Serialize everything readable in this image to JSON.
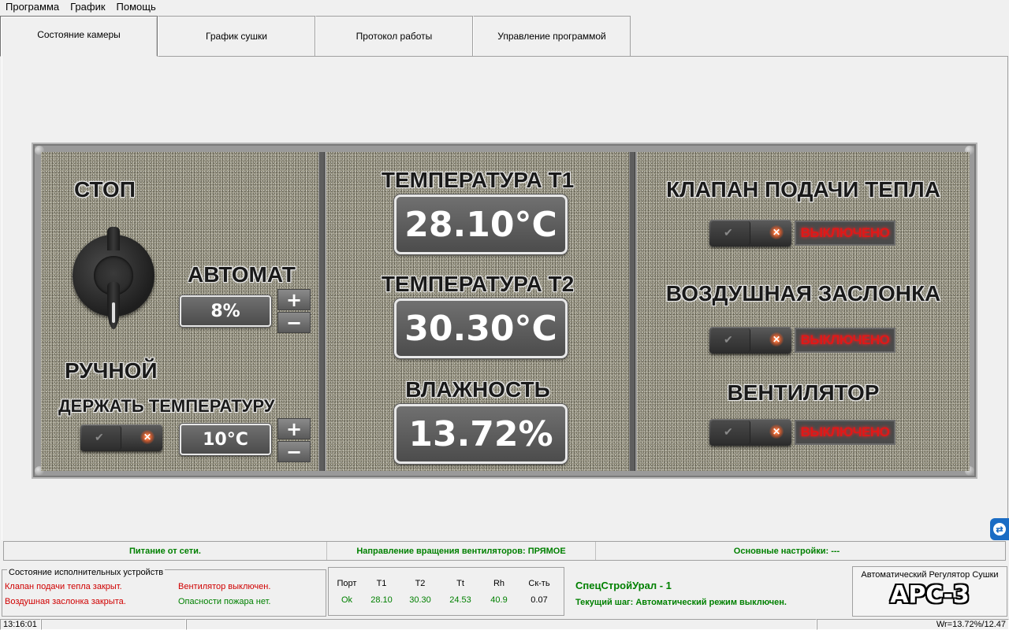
{
  "menu": [
    "Программа",
    "График",
    "Помощь"
  ],
  "tabs": [
    "Состояние камеры",
    "График сушки",
    "Протокол работы",
    "Управление программой"
  ],
  "mode": {
    "stop_label": "СТОП",
    "auto_label": "АВТОМАТ",
    "auto_value": "8%",
    "manual_label": "РУЧНОЙ",
    "hold_temp_label": "ДЕРЖАТЬ ТЕМПЕРАТУРУ",
    "hold_temp_value": "10°C",
    "plus": "+",
    "minus": "−"
  },
  "readings": {
    "t1_label": "ТЕМПЕРАТУРА Т1",
    "t1_value": "28.10°C",
    "t2_label": "ТЕМПЕРАТУРА Т2",
    "t2_value": "30.30°C",
    "hum_label": "ВЛАЖНОСТЬ",
    "hum_value": "13.72%"
  },
  "actuators": {
    "valve_label": "КЛАПАН ПОДАЧИ ТЕПЛА",
    "valve_state": "ВЫКЛЮЧЕНО",
    "damper_label": "ВОЗДУШНАЯ ЗАСЛОНКА",
    "damper_state": "ВЫКЛЮЧЕНО",
    "fan_label": "ВЕНТИЛЯТОР",
    "fan_state": "ВЫКЛЮЧЕНО"
  },
  "infobar": {
    "power": "Питание от сети.",
    "fan_direction": "Направление вращения вентиляторов: ПРЯМОЕ",
    "settings": "Основные настройки: ---"
  },
  "devices": {
    "title": "Состояние исполнительных устройств",
    "valve": "Клапан подачи тепла закрыт.",
    "damper": "Воздушная заслонка закрыта.",
    "fan": "Вентилятор выключен.",
    "fire": "Опасности пожара нет."
  },
  "sensors": {
    "headers": [
      "Порт",
      "T1",
      "T2",
      "Tt",
      "Rh",
      "Ск-ть"
    ],
    "values": [
      "Ok",
      "28.10",
      "30.30",
      "24.53",
      "40.9",
      "0.07"
    ]
  },
  "step": {
    "company": "СпецСтройУрал - 1",
    "current_step": "Текущий шаг:  Автоматический режим выключен."
  },
  "brand": {
    "subtitle": "Автоматический Регулятор Сушки",
    "model": "АРС-3"
  },
  "statusbar": {
    "time": "13:16:01",
    "wr": "Wr=13.72%/12.47"
  },
  "colors": {
    "status_red": "#e01818",
    "info_green": "#008000",
    "device_red": "#d00000"
  }
}
